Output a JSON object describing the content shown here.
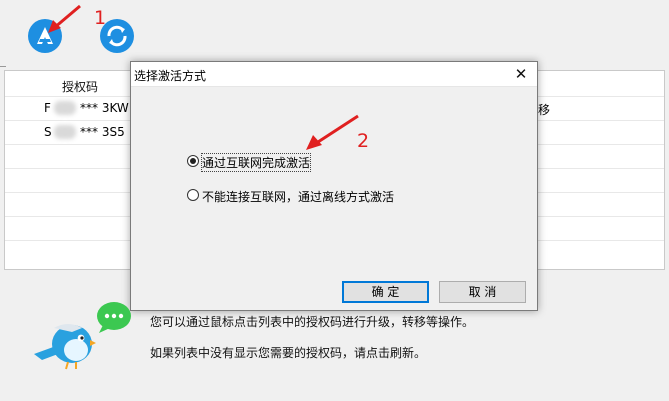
{
  "toolbar": {
    "activate_icon": "activate-icon",
    "refresh_icon": "refresh-icon"
  },
  "annotations": {
    "step1": "1",
    "step2": "2",
    "arrow_color": "#e02020"
  },
  "table": {
    "column_auth_code": "授权码",
    "rows": [
      {
        "code_prefix": "F",
        "code_suffix": "*** 3KW"
      },
      {
        "code_prefix": "S",
        "code_suffix": "*** 3S5"
      }
    ],
    "right_col_cell": "移"
  },
  "dialog": {
    "title": "选择激活方式",
    "close_glyph": "✕",
    "option_online": "通过互联网完成激活",
    "option_offline": "不能连接互联网，通过离线方式激活",
    "selected": "online",
    "ok_label": "确 定",
    "cancel_label": "取 消"
  },
  "footer": {
    "line1": "您可以通过鼠标点击列表中的授权码进行升级，转移等操作。",
    "line2": "如果列表中没有显示您需要的授权码，请点击刷新。",
    "bubble_icon": "chat-bubble-icon",
    "mascot": "bird-mascot"
  },
  "colors": {
    "accent": "#1e8fe1",
    "bubble": "#3cc851",
    "highlight": "#0078d7"
  }
}
